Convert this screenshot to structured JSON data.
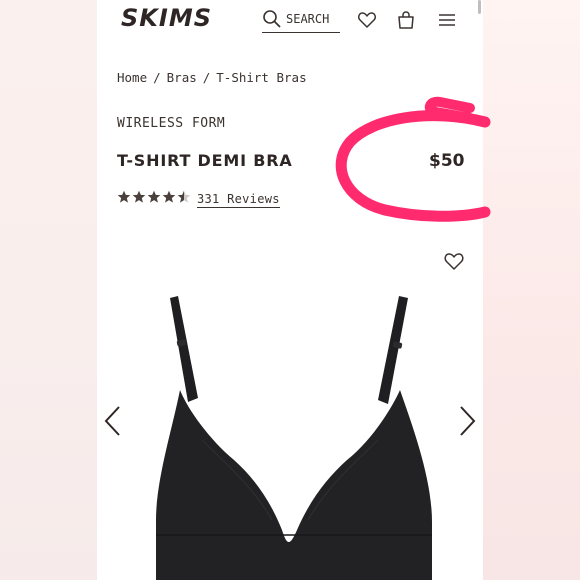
{
  "header": {
    "logo": "SKIMS",
    "search_label": "SEARCH"
  },
  "breadcrumb": {
    "items": [
      "Home",
      "Bras",
      "T-Shirt Bras"
    ],
    "separator": "/"
  },
  "product": {
    "subtitle": "WIRELESS FORM",
    "name": "T-SHIRT DEMI BRA",
    "price": "$50",
    "rating": 4.5,
    "reviews_label": "331 Reviews",
    "image_alt": "black wireless t-shirt demi bra"
  },
  "icons": {
    "search": "search-icon",
    "wishlist": "heart-icon",
    "bag": "shopping-bag-icon",
    "menu": "hamburger-menu-icon",
    "prev": "chevron-left-icon",
    "next": "chevron-right-icon"
  },
  "colors": {
    "text": "#2e2624",
    "annotation": "#ff2b6e",
    "star_filled": "#4a413c",
    "star_empty": "#cfcac7"
  }
}
